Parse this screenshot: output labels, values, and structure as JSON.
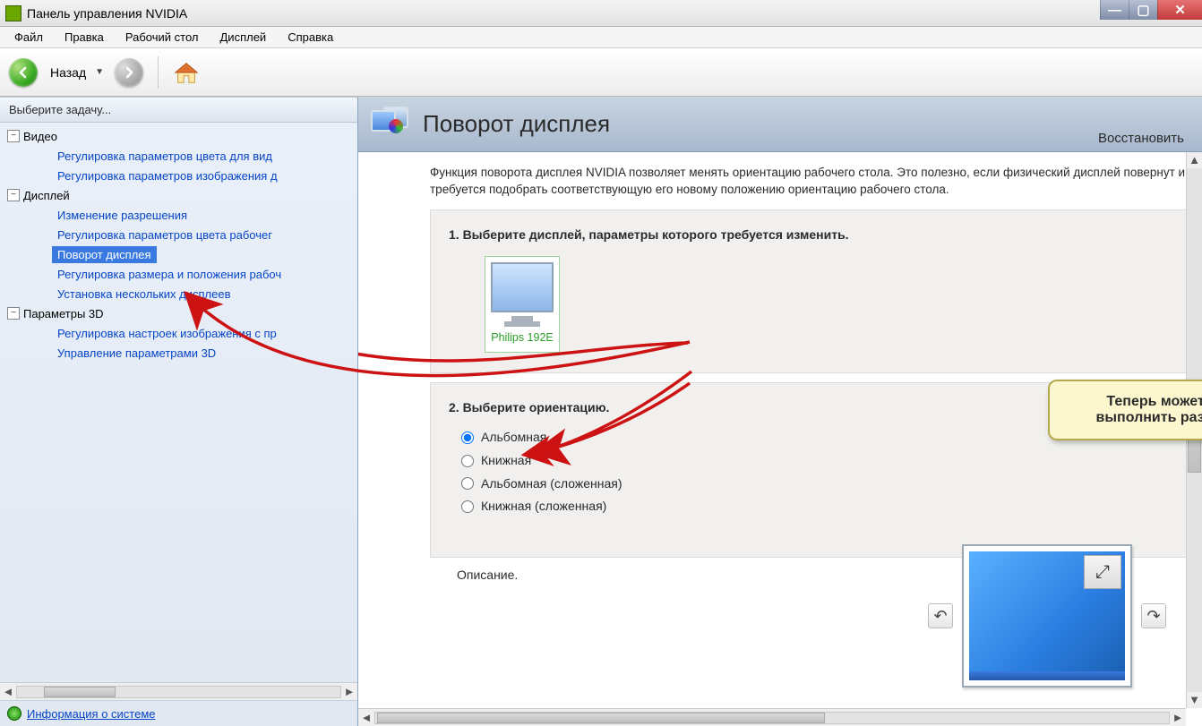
{
  "window": {
    "title": "Панель управления NVIDIA"
  },
  "menu": {
    "file": "Файл",
    "edit": "Правка",
    "desktop": "Рабочий стол",
    "display": "Дисплей",
    "help": "Справка"
  },
  "toolbar": {
    "back_label": "Назад"
  },
  "sidebar": {
    "header": "Выберите задачу...",
    "video_cat": "Видео",
    "video_items": {
      "0": "Регулировка параметров цвета для вид",
      "1": "Регулировка параметров изображения д"
    },
    "display_cat": "Дисплей",
    "display_items": {
      "0": "Изменение разрешения",
      "1": "Регулировка параметров цвета рабочег",
      "2": "Поворот дисплея",
      "3": "Регулировка размера и положения рабоч",
      "4": "Установка нескольких дисплеев"
    },
    "p3d_cat": "Параметры 3D",
    "p3d_items": {
      "0": "Регулировка настроек изображения с пр",
      "1": "Управление параметрами 3D"
    },
    "sysinfo": "Информация о системе"
  },
  "page": {
    "title": "Поворот дисплея",
    "restore": "Восстановить",
    "intro": "Функция поворота дисплея NVIDIA позволяет менять ориентацию рабочего стола. Это полезно, если физический дисплей повернут и требуется подобрать соответствующую его новому положению ориентацию рабочего стола.",
    "sec1_title": "1. Выберите дисплей, параметры которого требуется изменить.",
    "monitor_name": "Philips 192E",
    "sec2_title": "2. Выберите ориентацию.",
    "orientation": {
      "0": "Альбомная",
      "1": "Книжная",
      "2": "Альбомная (сложенная)",
      "3": "Книжная (сложенная)"
    },
    "desc_label": "Описание."
  },
  "callout": {
    "line1": "Теперь можете с легкостью",
    "line2": "выполнить разворот десплея!"
  }
}
